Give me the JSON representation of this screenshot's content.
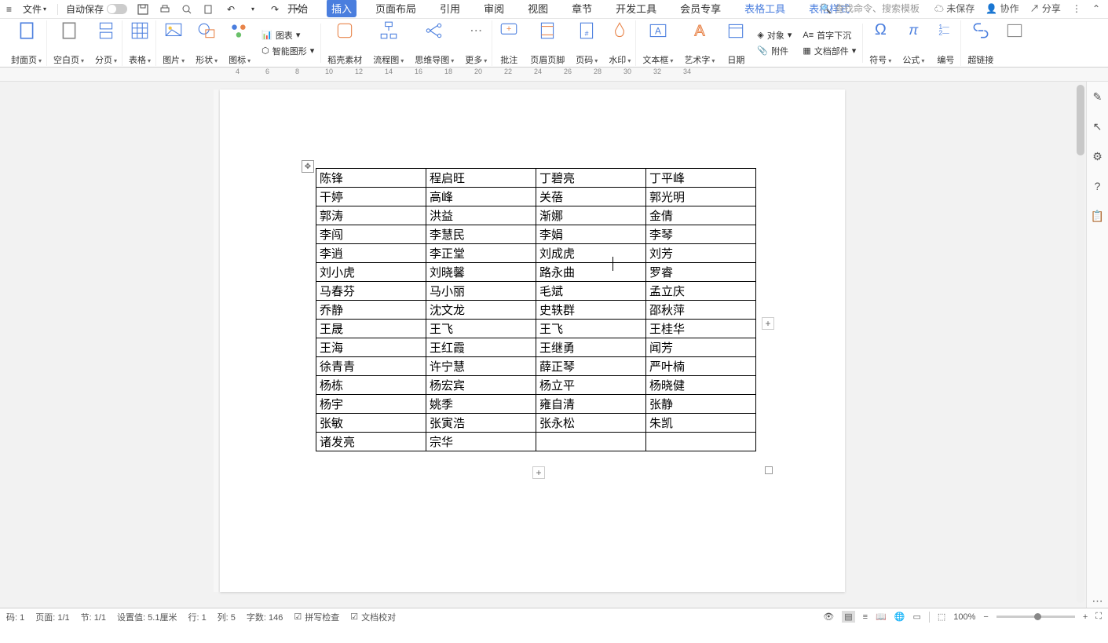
{
  "topbar": {
    "file_menu": "文件",
    "autosave": "自动保存",
    "unsaved": "未保存",
    "collab": "协作",
    "share": "分享"
  },
  "tabs": {
    "start": "开始",
    "insert": "插入",
    "layout": "页面布局",
    "ref": "引用",
    "review": "审阅",
    "view": "视图",
    "chapter": "章节",
    "devtools": "开发工具",
    "member": "会员专享",
    "tabletools": "表格工具",
    "tablestyle": "表格样式",
    "search_placeholder": "查找命令、搜索模板"
  },
  "ribbon": {
    "cover": "封面页",
    "blank": "空白页",
    "pagebreak": "分页",
    "table": "表格",
    "picture": "图片",
    "shape": "形状",
    "icon": "图标",
    "chart": "图表",
    "smartart": "智能图形",
    "docer": "稻壳素材",
    "flowchart": "流程图",
    "mindmap": "思维导图",
    "more": "更多",
    "comment": "批注",
    "headerfooter": "页眉页脚",
    "pagenum": "页码",
    "watermark": "水印",
    "textbox": "文本框",
    "wordart": "艺术字",
    "date": "日期",
    "object": "对象",
    "attachment": "附件",
    "dropcap": "首字下沉",
    "docparts": "文档部件",
    "symbol": "符号",
    "equation": "公式",
    "number": "编号",
    "hyperlink": "超链接"
  },
  "ruler_ticks": [
    "4",
    "6",
    "8",
    "10",
    "12",
    "14",
    "16",
    "18",
    "20",
    "22",
    "24",
    "26",
    "28",
    "30",
    "32",
    "34"
  ],
  "table_data": [
    [
      "陈锋",
      "程启旺",
      "丁碧亮",
      "丁平峰"
    ],
    [
      "干婷",
      "高峰",
      "关蓓",
      "郭光明"
    ],
    [
      "郭涛",
      "洪益",
      "渐娜",
      "金倩"
    ],
    [
      "李闯",
      "李慧民",
      "李娟",
      "李琴"
    ],
    [
      "李逍",
      "李正堂",
      "刘成虎",
      "刘芳"
    ],
    [
      "刘小虎",
      "刘晓馨",
      "路永曲",
      "罗睿"
    ],
    [
      "马春芬",
      "马小丽",
      "毛斌",
      "孟立庆"
    ],
    [
      "乔静",
      "沈文龙",
      "史轶群",
      "邵秋萍"
    ],
    [
      "王晟",
      "王飞",
      "王飞",
      "王桂华"
    ],
    [
      "王海",
      "王红霞",
      "王继勇",
      "闻芳"
    ],
    [
      "徐青青",
      "许宁慧",
      "薛正琴",
      "严叶楠"
    ],
    [
      "杨栋",
      "杨宏宾",
      "杨立平",
      "杨晓健"
    ],
    [
      "杨宇",
      "姚季",
      "雍自清",
      "张静"
    ],
    [
      "张敏",
      "张寅浩",
      "张永松",
      "朱凯"
    ],
    [
      "诸发亮",
      "宗华",
      "",
      ""
    ]
  ],
  "status": {
    "page_code": "码: 1",
    "page": "页面: 1/1",
    "section": "节: 1/1",
    "position": "设置值: 5.1厘米",
    "row": "行: 1",
    "col": "列: 5",
    "wordcount": "字数: 146",
    "spellcheck": "拼写检查",
    "proofread": "文档校对",
    "zoom": "100%"
  }
}
